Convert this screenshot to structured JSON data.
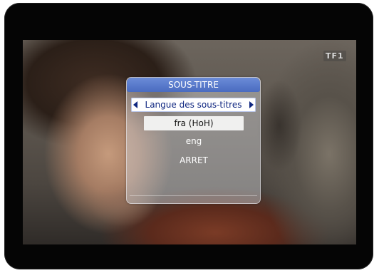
{
  "overlay": {
    "channel_logo": "TF1"
  },
  "subtitle_menu": {
    "title": "SOUS-TITRE",
    "selector_label": "Langue des sous-titres",
    "options": [
      {
        "label": "fra (HoH)",
        "selected": true
      },
      {
        "label": "eng",
        "selected": false
      },
      {
        "label": "ARRET",
        "selected": false
      }
    ]
  },
  "colors": {
    "title_bar": "#4a6bc0",
    "selector_text": "#0e2680",
    "panel_bg": "#d2d4da"
  }
}
